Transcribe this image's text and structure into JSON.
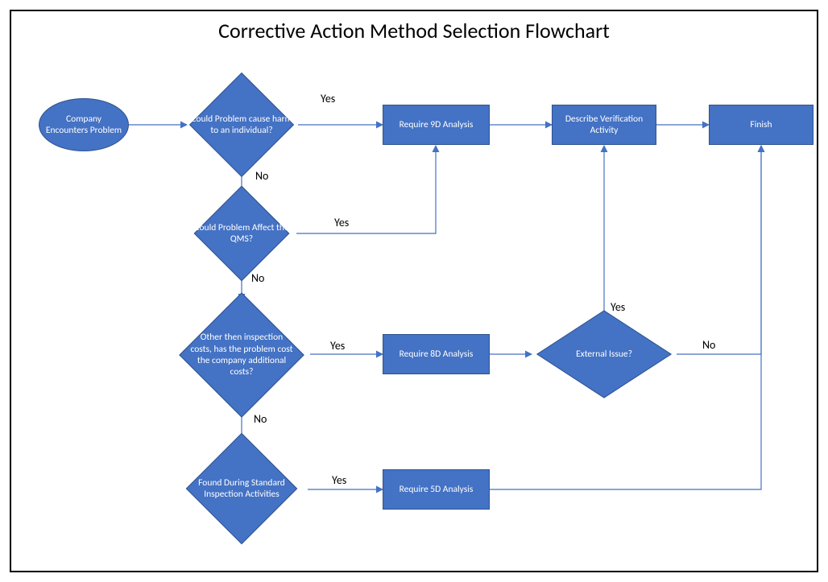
{
  "title": "Corrective Action Method Selection Flowchart",
  "nodes": {
    "start": "Company Encounters Problem",
    "d1": "Could Problem cause harm to an individual?",
    "d2": "Could Problem Affect the QMS?",
    "d3": "Other then inspection costs, has the problem cost the company additional costs?",
    "d4": "Found During Standard Inspection Activities",
    "r9d": "Require 9D Analysis",
    "r8d": "Require 8D Analysis",
    "r5d": "Require 5D Analysis",
    "verify": "Describe Verification Activity",
    "finish": "Finish",
    "dExt": "External Issue?"
  },
  "labels": {
    "yes": "Yes",
    "no": "No"
  },
  "colors": {
    "fill": "#4472C4",
    "stroke": "#2F528F",
    "arrow": "#4472C4"
  }
}
